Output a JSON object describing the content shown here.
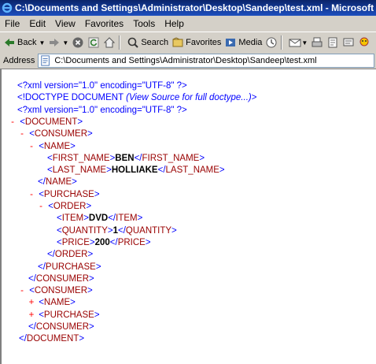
{
  "window": {
    "title": "C:\\Documents and Settings\\Administrator\\Desktop\\Sandeep\\test.xml - Microsoft Internet Explorer"
  },
  "menu": [
    "File",
    "Edit",
    "View",
    "Favorites",
    "Tools",
    "Help"
  ],
  "toolbar": {
    "back_label": "Back",
    "search_label": "Search",
    "favorites_label": "Favorites",
    "media_label": "Media"
  },
  "address": {
    "label": "Address",
    "value": "C:\\Documents and Settings\\Administrator\\Desktop\\Sandeep\\test.xml"
  },
  "xml": {
    "decl1": "<?xml version=\"1.0\" encoding=\"UTF-8\" ?>",
    "doctype": "<!DOCTYPE DOCUMENT",
    "doctype_note": "(View Source for full doctype...)",
    "doctype_end": ">",
    "decl2": "<?xml version=\"1.0\" encoding=\"UTF-8\" ?>",
    "document": "DOCUMENT",
    "consumer": "CONSUMER",
    "name": "NAME",
    "first_name": "FIRST_NAME",
    "first_name_value": "BEN",
    "last_name": "LAST_NAME",
    "last_name_value": "HOLLIAKE",
    "purchase": "PURCHASE",
    "order": "ORDER",
    "item": "ITEM",
    "item_value": "DVD",
    "quantity": "QUANTITY",
    "quantity_value": "1",
    "price": "PRICE",
    "price_value": "200",
    "minus": "-",
    "plus": "+"
  }
}
